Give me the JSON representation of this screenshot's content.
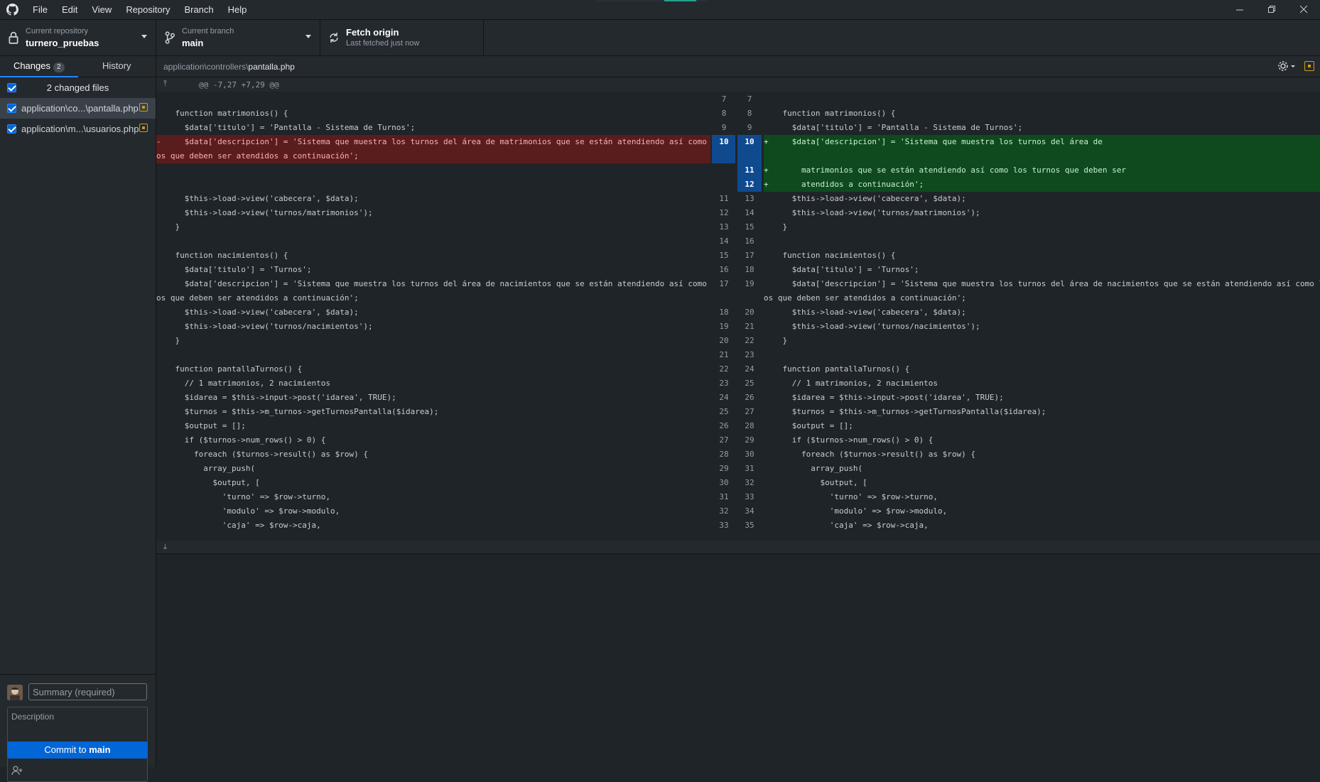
{
  "menu": [
    "File",
    "Edit",
    "View",
    "Repository",
    "Branch",
    "Help"
  ],
  "toolbar": {
    "repo_label": "Current repository",
    "repo_value": "turnero_pruebas",
    "branch_label": "Current branch",
    "branch_value": "main",
    "fetch_label": "Fetch origin",
    "fetch_sub": "Last fetched just now"
  },
  "sidebar": {
    "tab_changes": "Changes",
    "tab_changes_count": "2",
    "tab_history": "History",
    "changed_files_label": "2 changed files",
    "files": [
      {
        "name": "application\\co...\\pantalla.php"
      },
      {
        "name": "application\\m...\\usuarios.php"
      }
    ]
  },
  "commit": {
    "summary_placeholder": "Summary (required)",
    "description_placeholder": "Description",
    "button_prefix": "Commit to ",
    "button_branch": "main"
  },
  "diff": {
    "path_dir": "application\\controllers\\",
    "path_file": "pantalla.php",
    "hunk_header": "@@ -7,27 +7,29 @@",
    "rows": [
      {
        "o": "7",
        "n": "7",
        "l": "",
        "r": "",
        "t": "ctx"
      },
      {
        "o": "8",
        "n": "8",
        "l": "    function matrimonios() {",
        "r": "    function matrimonios() {",
        "t": "ctx"
      },
      {
        "o": "9",
        "n": "9",
        "l": "      $data['titulo'] = 'Pantalla - Sistema de Turnos';",
        "r": "      $data['titulo'] = 'Pantalla - Sistema de Turnos';",
        "t": "ctx"
      },
      {
        "o": "10",
        "n": "10",
        "l": "-     $data['descripcion'] = 'Sistema que muestra los turnos del área de matrimonios que se están atendiendo así como los turn",
        "r": "+     $data['descripcion'] = 'Sistema que muestra los turnos del área de",
        "t": "both"
      },
      {
        "o": "",
        "n": "",
        "l": "os que deben ser atendidos a continuación';",
        "r": "",
        "t": "both"
      },
      {
        "o": "",
        "n": "11",
        "l": "",
        "r": "+       matrimonios que se están atendiendo así como los turnos que deben ser",
        "t": "addonly"
      },
      {
        "o": "",
        "n": "12",
        "l": "",
        "r": "+       atendidos a continuación';",
        "t": "addonly"
      },
      {
        "o": "11",
        "n": "13",
        "l": "      $this->load->view('cabecera', $data);",
        "r": "      $this->load->view('cabecera', $data);",
        "t": "ctx"
      },
      {
        "o": "12",
        "n": "14",
        "l": "      $this->load->view('turnos/matrimonios');",
        "r": "      $this->load->view('turnos/matrimonios');",
        "t": "ctx"
      },
      {
        "o": "13",
        "n": "15",
        "l": "    }",
        "r": "    }",
        "t": "ctx"
      },
      {
        "o": "14",
        "n": "16",
        "l": "",
        "r": "",
        "t": "ctx"
      },
      {
        "o": "15",
        "n": "17",
        "l": "    function nacimientos() {",
        "r": "    function nacimientos() {",
        "t": "ctx"
      },
      {
        "o": "16",
        "n": "18",
        "l": "      $data['titulo'] = 'Turnos';",
        "r": "      $data['titulo'] = 'Turnos';",
        "t": "ctx"
      },
      {
        "o": "17",
        "n": "19",
        "l": "      $data['descripcion'] = 'Sistema que muestra los turnos del área de nacimientos que se están atendiendo así como los turn",
        "r": "      $data['descripcion'] = 'Sistema que muestra los turnos del área de nacimientos que se están atendiendo así como los turn",
        "t": "ctx"
      },
      {
        "o": "",
        "n": "",
        "l": "os que deben ser atendidos a continuación';",
        "r": "os que deben ser atendidos a continuación';",
        "t": "ctx"
      },
      {
        "o": "18",
        "n": "20",
        "l": "      $this->load->view('cabecera', $data);",
        "r": "      $this->load->view('cabecera', $data);",
        "t": "ctx"
      },
      {
        "o": "19",
        "n": "21",
        "l": "      $this->load->view('turnos/nacimientos');",
        "r": "      $this->load->view('turnos/nacimientos');",
        "t": "ctx"
      },
      {
        "o": "20",
        "n": "22",
        "l": "    }",
        "r": "    }",
        "t": "ctx"
      },
      {
        "o": "21",
        "n": "23",
        "l": "",
        "r": "",
        "t": "ctx"
      },
      {
        "o": "22",
        "n": "24",
        "l": "    function pantallaTurnos() {",
        "r": "    function pantallaTurnos() {",
        "t": "ctx"
      },
      {
        "o": "23",
        "n": "25",
        "l": "      // 1 matrimonios, 2 nacimientos",
        "r": "      // 1 matrimonios, 2 nacimientos",
        "t": "ctx"
      },
      {
        "o": "24",
        "n": "26",
        "l": "      $idarea = $this->input->post('idarea', TRUE);",
        "r": "      $idarea = $this->input->post('idarea', TRUE);",
        "t": "ctx"
      },
      {
        "o": "25",
        "n": "27",
        "l": "      $turnos = $this->m_turnos->getTurnosPantalla($idarea);",
        "r": "      $turnos = $this->m_turnos->getTurnosPantalla($idarea);",
        "t": "ctx"
      },
      {
        "o": "26",
        "n": "28",
        "l": "      $output = [];",
        "r": "      $output = [];",
        "t": "ctx"
      },
      {
        "o": "27",
        "n": "29",
        "l": "      if ($turnos->num_rows() > 0) {",
        "r": "      if ($turnos->num_rows() > 0) {",
        "t": "ctx"
      },
      {
        "o": "28",
        "n": "30",
        "l": "        foreach ($turnos->result() as $row) {",
        "r": "        foreach ($turnos->result() as $row) {",
        "t": "ctx"
      },
      {
        "o": "29",
        "n": "31",
        "l": "          array_push(",
        "r": "          array_push(",
        "t": "ctx"
      },
      {
        "o": "30",
        "n": "32",
        "l": "            $output, [",
        "r": "            $output, [",
        "t": "ctx"
      },
      {
        "o": "31",
        "n": "33",
        "l": "              'turno' => $row->turno,",
        "r": "              'turno' => $row->turno,",
        "t": "ctx"
      },
      {
        "o": "32",
        "n": "34",
        "l": "              'modulo' => $row->modulo,",
        "r": "              'modulo' => $row->modulo,",
        "t": "ctx"
      },
      {
        "o": "33",
        "n": "35",
        "l": "              'caja' => $row->caja,",
        "r": "              'caja' => $row->caja,",
        "t": "ctx"
      }
    ]
  },
  "colors": {
    "accent": "#0366d6",
    "deleted_bg": "#5a1d1d",
    "added_bg": "#0f4a1f",
    "modified_badge": "#d29b14"
  }
}
